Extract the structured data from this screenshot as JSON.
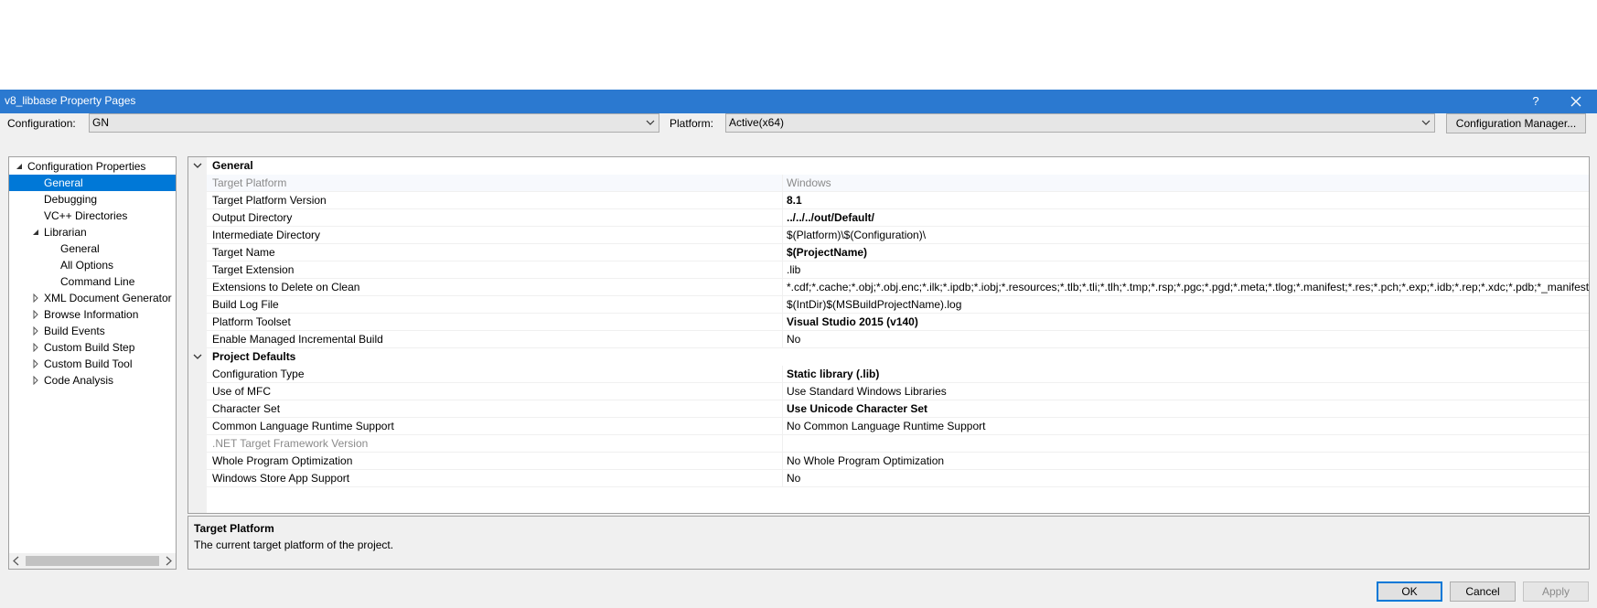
{
  "window": {
    "title": "v8_libbase Property Pages",
    "help_glyph": "?"
  },
  "toolbar": {
    "configuration_label": "Configuration:",
    "configuration_value": "GN",
    "platform_label": "Platform:",
    "platform_value": "Active(x64)",
    "config_manager_label": "Configuration Manager..."
  },
  "tree": {
    "items": [
      {
        "label": "Configuration Properties",
        "state": "expanded"
      },
      {
        "label": "General",
        "selected": true
      },
      {
        "label": "Debugging"
      },
      {
        "label": "VC++ Directories"
      },
      {
        "label": "Librarian",
        "state": "expanded"
      },
      {
        "label": "General"
      },
      {
        "label": "All Options"
      },
      {
        "label": "Command Line"
      },
      {
        "label": "XML Document Generator",
        "state": "collapsed"
      },
      {
        "label": "Browse Information",
        "state": "collapsed"
      },
      {
        "label": "Build Events",
        "state": "collapsed"
      },
      {
        "label": "Custom Build Step",
        "state": "collapsed"
      },
      {
        "label": "Custom Build Tool",
        "state": "collapsed"
      },
      {
        "label": "Code Analysis",
        "state": "collapsed"
      }
    ]
  },
  "grid": {
    "categories": [
      {
        "name": "General",
        "rows": [
          {
            "name": "Target Platform",
            "value": "Windows",
            "disabled": true
          },
          {
            "name": "Target Platform Version",
            "value": "8.1",
            "bold": true
          },
          {
            "name": "Output Directory",
            "value": "../../../out/Default/",
            "bold": true
          },
          {
            "name": "Intermediate Directory",
            "value": "$(Platform)\\$(Configuration)\\"
          },
          {
            "name": "Target Name",
            "value": "$(ProjectName)",
            "bold": true
          },
          {
            "name": "Target Extension",
            "value": ".lib"
          },
          {
            "name": "Extensions to Delete on Clean",
            "value": "*.cdf;*.cache;*.obj;*.obj.enc;*.ilk;*.ipdb;*.iobj;*.resources;*.tlb;*.tli;*.tlh;*.tmp;*.rsp;*.pgc;*.pgd;*.meta;*.tlog;*.manifest;*.res;*.pch;*.exp;*.idb;*.rep;*.xdc;*.pdb;*_manifest.rc;*.bsc;*.sbr;*.xml;*.metagen;*.bi"
          },
          {
            "name": "Build Log File",
            "value": "$(IntDir)$(MSBuildProjectName).log"
          },
          {
            "name": "Platform Toolset",
            "value": "Visual Studio 2015 (v140)",
            "bold": true
          },
          {
            "name": "Enable Managed Incremental Build",
            "value": "No"
          }
        ]
      },
      {
        "name": "Project Defaults",
        "rows": [
          {
            "name": "Configuration Type",
            "value": "Static library (.lib)",
            "bold": true
          },
          {
            "name": "Use of MFC",
            "value": "Use Standard Windows Libraries"
          },
          {
            "name": "Character Set",
            "value": "Use Unicode Character Set",
            "bold": true
          },
          {
            "name": "Common Language Runtime Support",
            "value": "No Common Language Runtime Support"
          },
          {
            "name": ".NET Target Framework Version",
            "value": "",
            "disabled": true
          },
          {
            "name": "Whole Program Optimization",
            "value": "No Whole Program Optimization"
          },
          {
            "name": "Windows Store App Support",
            "value": "No"
          }
        ]
      }
    ]
  },
  "description": {
    "title": "Target Platform",
    "text": "The current target platform of the project."
  },
  "buttons": {
    "ok": "OK",
    "cancel": "Cancel",
    "apply": "Apply"
  },
  "colors": {
    "titlebar": "#2b79d0",
    "selection": "#0078d7",
    "disabled_text": "#8a8a8a"
  }
}
